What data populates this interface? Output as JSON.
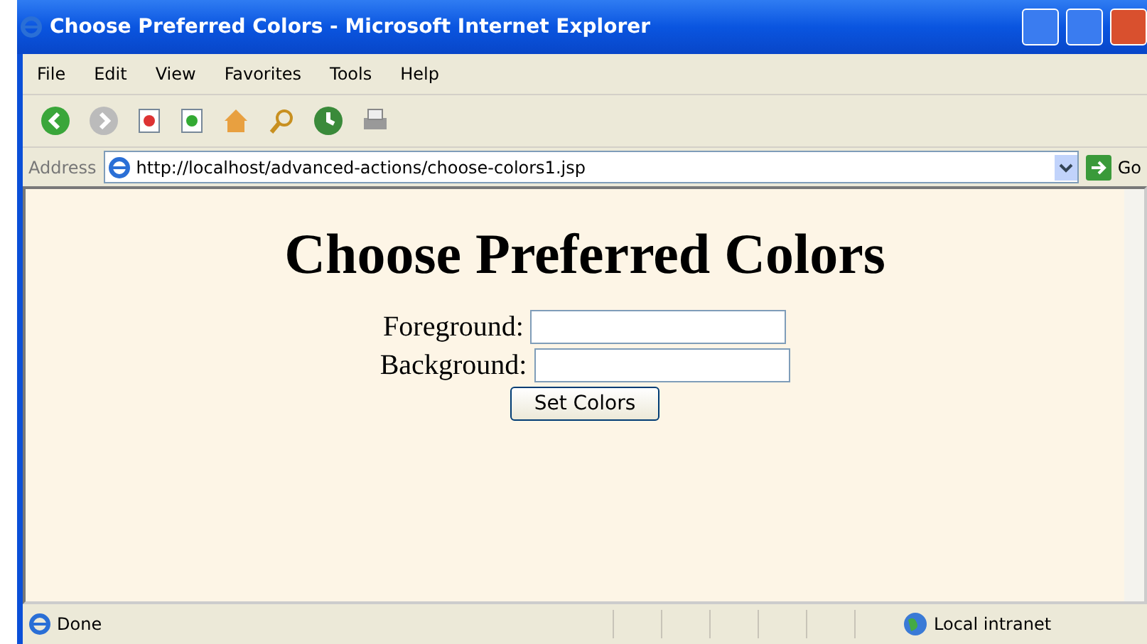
{
  "window": {
    "title": "Choose Preferred Colors - Microsoft Internet Explorer"
  },
  "menu": [
    "File",
    "Edit",
    "View",
    "Favorites",
    "Tools",
    "Help"
  ],
  "address": {
    "label": "Address",
    "value": "http://localhost/advanced-actions/choose-colors1.jsp",
    "go": "Go"
  },
  "page": {
    "heading": "Choose Preferred Colors",
    "fields": [
      {
        "label": "Foreground:"
      },
      {
        "label": "Background:"
      }
    ],
    "button": "Set Colors"
  },
  "status_bar": {
    "text": "Done",
    "zone": "Local intranet"
  }
}
